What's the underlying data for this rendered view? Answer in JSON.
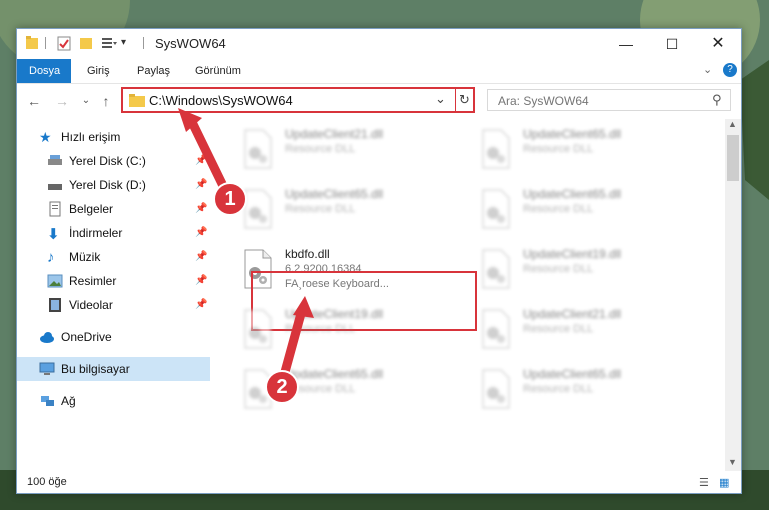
{
  "window": {
    "title": "SysWOW64"
  },
  "ribbon": {
    "tabs": [
      "Dosya",
      "Giriş",
      "Paylaş",
      "Görünüm"
    ]
  },
  "address": {
    "path": "C:\\Windows\\SysWOW64"
  },
  "search": {
    "placeholder": "Ara: SysWOW64"
  },
  "sidebar": {
    "quick_access": "Hızlı erişim",
    "items": [
      {
        "label": "Yerel Disk (C:)",
        "icon": "drive-icon"
      },
      {
        "label": "Yerel Disk (D:)",
        "icon": "drive-icon"
      },
      {
        "label": "Belgeler",
        "icon": "documents-icon"
      },
      {
        "label": "İndirmeler",
        "icon": "download-icon"
      },
      {
        "label": "Müzik",
        "icon": "music-icon"
      },
      {
        "label": "Resimler",
        "icon": "pictures-icon"
      },
      {
        "label": "Videolar",
        "icon": "videos-icon"
      }
    ],
    "onedrive": "OneDrive",
    "this_pc": "Bu bilgisayar",
    "network": "Ağ"
  },
  "files": {
    "left": [
      {
        "name": "UpdateClient21.dll",
        "desc": "Resource DLL"
      },
      {
        "name": "UpdateClient65.dll",
        "desc": "Resource DLL"
      },
      {
        "name": "kbdfo.dll",
        "version": "6.2.9200.16384",
        "desc": "FA¸roese Keyboard..."
      },
      {
        "name": "UpdateClient19.dll",
        "desc": "Resource DLL"
      },
      {
        "name": "UpdateClient65.dll",
        "desc": "Resource DLL"
      }
    ],
    "right": [
      {
        "name": "UpdateClient65.dll",
        "desc": "Resource DLL"
      },
      {
        "name": "UpdateClient65.dll",
        "desc": "Resource DLL"
      },
      {
        "name": "UpdateClient19.dll",
        "desc": "Resource DLL"
      },
      {
        "name": "UpdateClient21.dll",
        "desc": "Resource DLL"
      },
      {
        "name": "UpdateClient65.dll",
        "desc": "Resource DLL"
      }
    ]
  },
  "status": {
    "count": "100 öğe"
  },
  "annotations": {
    "step1": "1",
    "step2": "2"
  },
  "colors": {
    "accent": "#1979ca",
    "highlight": "#d8343b",
    "selection": "#cce4f7"
  }
}
